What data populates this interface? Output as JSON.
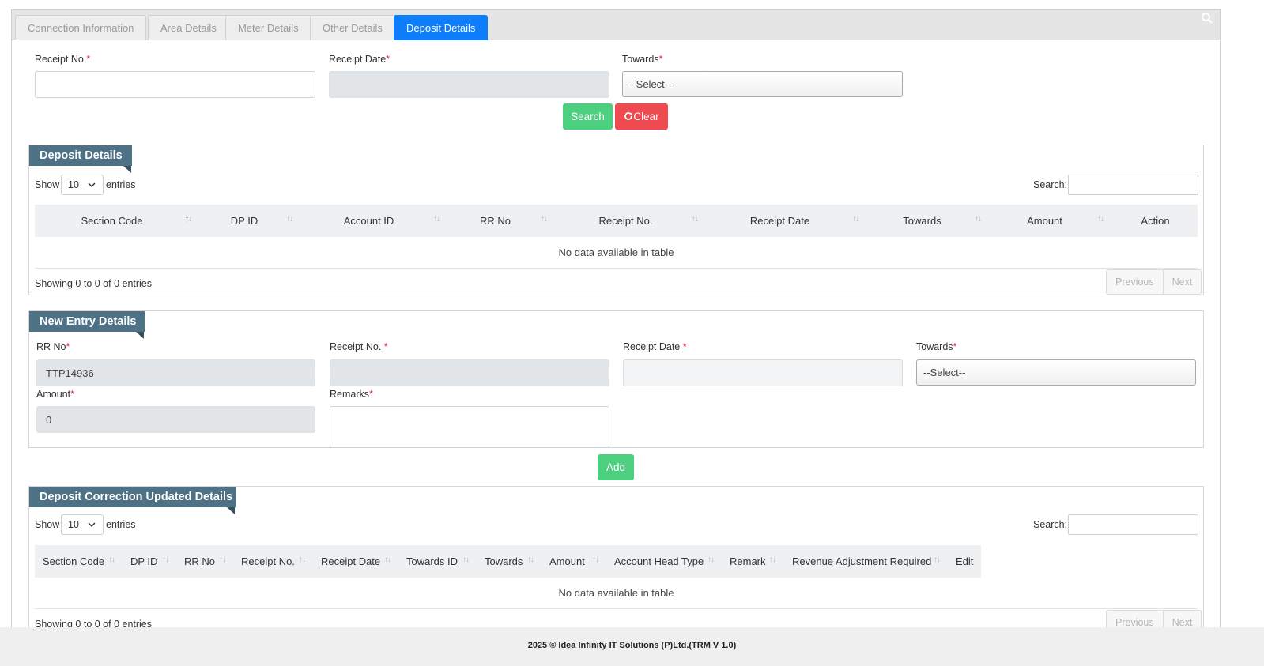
{
  "tabs": [
    {
      "label": "Connection Information",
      "active": false
    },
    {
      "label": "Area Details",
      "active": false
    },
    {
      "label": "Meter Details",
      "active": false
    },
    {
      "label": "Other Details",
      "active": false
    },
    {
      "label": "Deposit Details",
      "active": true
    }
  ],
  "search_form": {
    "receipt_no_label": "Receipt No.",
    "receipt_no_value": "",
    "receipt_date_label": "Receipt Date",
    "receipt_date_value": "",
    "towards_label": "Towards",
    "towards_selected": "--Select--",
    "search_label": "Search",
    "clear_label": "Clear",
    "required_mark": "*"
  },
  "deposit_details": {
    "title": "Deposit Details",
    "show_label": "Show",
    "entries_label": "entries",
    "page_length": "10",
    "search_label": "Search:",
    "columns": [
      "Section Code",
      "DP ID",
      "Account ID",
      "RR No",
      "Receipt No.",
      "Receipt Date",
      "Towards",
      "Amount",
      "Action"
    ],
    "empty_message": "No data available in table",
    "info": "Showing 0 to 0 of 0 entries",
    "previous_label": "Previous",
    "next_label": "Next"
  },
  "new_entry": {
    "title": "New Entry Details",
    "rr_no_label": "RR No",
    "rr_no_value": "TTP14936",
    "receipt_no_label": "Receipt No. ",
    "receipt_no_value": "",
    "receipt_date_label": "Receipt Date ",
    "receipt_date_value": "",
    "towards_label": "Towards",
    "towards_selected": "--Select--",
    "amount_label": "Amount",
    "amount_value": "0",
    "remarks_label": "Remarks",
    "remarks_value": "",
    "add_label": "Add"
  },
  "correction_details": {
    "title": "Deposit Correction Updated Details",
    "show_label": "Show",
    "entries_label": "entries",
    "page_length": "10",
    "search_label": "Search:",
    "columns": [
      "Section Code",
      "DP ID",
      "RR No",
      "Receipt No.",
      "Receipt Date",
      "Towards ID",
      "Towards",
      "Amount",
      "Account Head Type",
      "Remark",
      "Revenue Adjustment Required",
      "Edit"
    ],
    "empty_message": "No data available in table",
    "info": "Showing 0 to 0 of 0 entries",
    "previous_label": "Previous",
    "next_label": "Next"
  },
  "footer": {
    "text": "2025 © Idea Infinity IT Solutions (P)Ltd.(TRM V 1.0)"
  },
  "colors": {
    "active_tab": "#0d7dfc",
    "success": "#4cd080",
    "danger": "#ef4a4f",
    "ribbon": "#4f7186",
    "required": "#e0233a"
  }
}
